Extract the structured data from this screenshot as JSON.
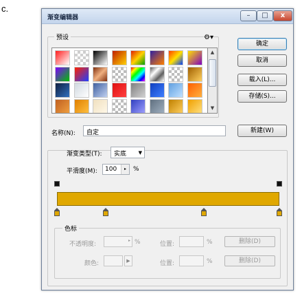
{
  "caption": "c.",
  "window": {
    "title": "渐变编辑器",
    "controls": {
      "minimize": "–",
      "maximize": "□",
      "close": "x"
    }
  },
  "presets": {
    "label": "预设",
    "gear_icon": "gear-icon",
    "rows": [
      [
        "red-white",
        "transparent",
        "black-white",
        "orange-yellow",
        "red-green",
        "purple-orange",
        "red-gold-blue",
        "yellow-purple"
      ],
      [
        "violet-green",
        "red-blue",
        "copper",
        "checker",
        "rainbow",
        "chrome",
        "checker",
        "gold"
      ],
      [
        "blue-dark",
        "blue-light",
        "steel-blue",
        "red",
        "gray",
        "blue",
        "sky",
        "orange"
      ],
      [
        "orange-tan",
        "orange-gold",
        "cream",
        "checker",
        "blue-violet",
        "slate",
        "gold-warm",
        "gold-bright"
      ]
    ],
    "colors": {
      "red-white": "linear-gradient(135deg,#ff2020,#ffffff)",
      "transparent": "repeating-conic-gradient(#cfcfcf 0 25%,#ffffff 0 50%) 0 0/8px 8px",
      "black-white": "linear-gradient(135deg,#000000,#ffffff)",
      "orange-yellow": "linear-gradient(135deg,#c02000,#ffd000)",
      "red-green": "linear-gradient(135deg,#e02000,#ffd000,#00a000)",
      "purple-orange": "linear-gradient(135deg,#3020a0,#ff8000)",
      "red-gold-blue": "linear-gradient(135deg,#ff4000,#ffe000,#0040ff)",
      "yellow-purple": "linear-gradient(135deg,#ffe000,#8000c0)",
      "violet-green": "linear-gradient(135deg,#8000ff,#00c000)",
      "red-blue": "linear-gradient(135deg,#ff2000,#2040ff)",
      "copper": "linear-gradient(135deg,#803010,#f0b080,#803010)",
      "checker": "repeating-conic-gradient(#bdbdbd 0 25%,#ffffff 0 50%) 0 0/8px 8px",
      "rainbow": "linear-gradient(135deg,#ff0000,#ffff00,#00ff00,#00ffff,#0000ff,#ff00ff)",
      "chrome": "linear-gradient(135deg,#606060,#ffffff,#606060,#ffffff)",
      "gold": "linear-gradient(135deg,#a06000,#ffd060)",
      "blue-dark": "linear-gradient(135deg,#102040,#3070c0)",
      "blue-light": "linear-gradient(135deg,#d0d8e0,#ffffff)",
      "steel-blue": "linear-gradient(135deg,#4060a0,#c0d0f0)",
      "red": "linear-gradient(135deg,#e01010,#ff4040)",
      "gray": "linear-gradient(135deg,#808080,#d0d0d0)",
      "blue": "linear-gradient(135deg,#1040c0,#4080ff)",
      "sky": "linear-gradient(135deg,#60a0e0,#c0e0ff)",
      "orange": "linear-gradient(135deg,#ff6000,#ffb040)",
      "orange-tan": "linear-gradient(135deg,#c06020,#f0a040)",
      "orange-gold": "linear-gradient(135deg,#e08000,#ffc040)",
      "cream": "linear-gradient(135deg,#f0e0c0,#fff8e8)",
      "blue-violet": "linear-gradient(135deg,#3040c0,#a0a0ff)",
      "slate": "linear-gradient(135deg,#607080,#a0b0c0)",
      "gold-warm": "linear-gradient(135deg,#c08000,#ffd060)",
      "gold-bright": "linear-gradient(135deg,#f0a000,#ffe080)"
    }
  },
  "buttons": {
    "ok": "确定",
    "cancel": "取消",
    "load": "载入(L)...",
    "save": "存储(S)...",
    "new": "新建(W)"
  },
  "name": {
    "label": "名称(N):",
    "value": "自定"
  },
  "gradient_type": {
    "label": "渐变类型(T):",
    "value": "实底"
  },
  "smoothness": {
    "label": "平滑度(M):",
    "value": "100",
    "unit": "%"
  },
  "gradient": {
    "color": "#e0a800",
    "opacity_stops": [
      0,
      1
    ],
    "color_stops": [
      0,
      0.22,
      0.66,
      1
    ]
  },
  "stops": {
    "label": "色标",
    "opacity_label": "不透明度:",
    "opacity_unit": "%",
    "color_label": "颜色:",
    "location_label": "位置:",
    "location_unit": "%",
    "delete_label": "删除(D)"
  }
}
